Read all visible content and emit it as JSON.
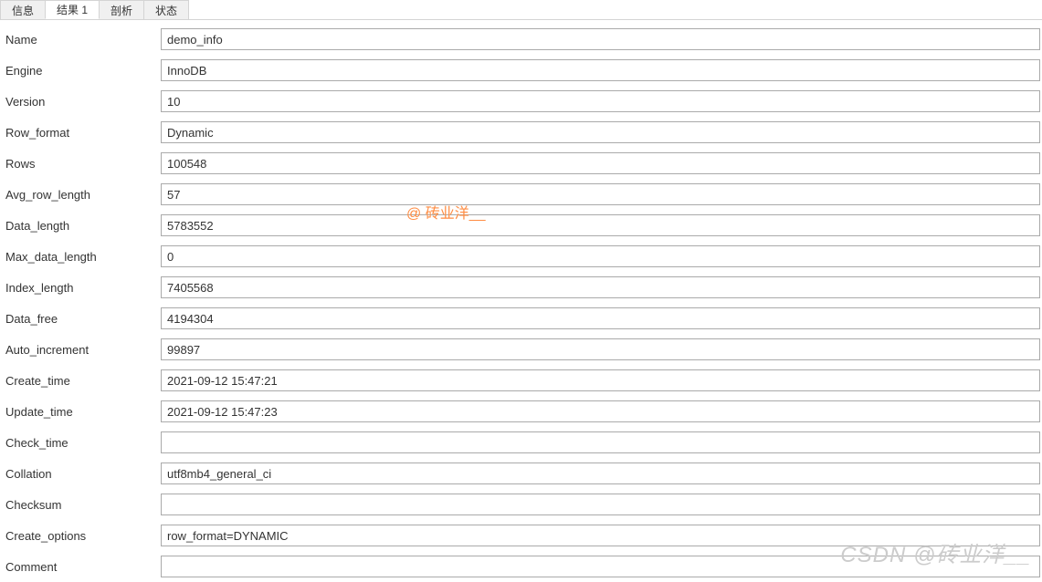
{
  "tabs": {
    "info": "信息",
    "result1": "结果 1",
    "analysis": "剖析",
    "status": "状态"
  },
  "fields": {
    "name": {
      "label": "Name",
      "value": "demo_info"
    },
    "engine": {
      "label": "Engine",
      "value": "InnoDB"
    },
    "version": {
      "label": "Version",
      "value": "10"
    },
    "row_format": {
      "label": "Row_format",
      "value": "Dynamic"
    },
    "rows": {
      "label": "Rows",
      "value": "100548"
    },
    "avg_row_length": {
      "label": "Avg_row_length",
      "value": "57"
    },
    "data_length": {
      "label": "Data_length",
      "value": "5783552"
    },
    "max_data_length": {
      "label": "Max_data_length",
      "value": "0"
    },
    "index_length": {
      "label": "Index_length",
      "value": "7405568"
    },
    "data_free": {
      "label": "Data_free",
      "value": "4194304"
    },
    "auto_increment": {
      "label": "Auto_increment",
      "value": "99897"
    },
    "create_time": {
      "label": "Create_time",
      "value": "2021-09-12 15:47:21"
    },
    "update_time": {
      "label": "Update_time",
      "value": "2021-09-12 15:47:23"
    },
    "check_time": {
      "label": "Check_time",
      "value": ""
    },
    "collation": {
      "label": "Collation",
      "value": "utf8mb4_general_ci"
    },
    "checksum": {
      "label": "Checksum",
      "value": ""
    },
    "create_options": {
      "label": "Create_options",
      "value": "row_format=DYNAMIC"
    },
    "comment": {
      "label": "Comment",
      "value": ""
    }
  },
  "watermarks": {
    "center": "@ 砖业洋__",
    "bottom": "CSDN @砖业洋__"
  }
}
